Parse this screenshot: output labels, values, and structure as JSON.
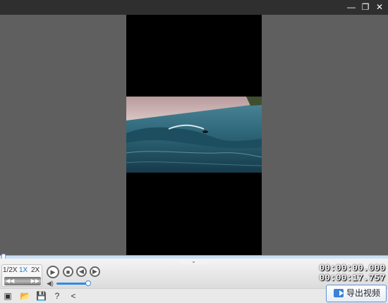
{
  "window": {
    "minimize_glyph": "—",
    "restore_glyph": "❐",
    "close_glyph": "✕"
  },
  "controls": {
    "speed_options": [
      "1/2X",
      "1X",
      "2X"
    ],
    "active_speed": "1X",
    "jog_left": "◀◀",
    "jog_right": "▶▶",
    "play_glyph": "▶",
    "stop_glyph": "■",
    "prev_glyph": "◀",
    "next_glyph": "▶",
    "volume_glyph": "◀)",
    "collapse_glyph": "⌄",
    "volume_level": 0.85,
    "progress": 0.0
  },
  "timecodes": {
    "current": "00:00:00.000",
    "total": "00:00:17.757"
  },
  "toolbar": {
    "tool1_glyph": "▣",
    "tool2_glyph": "📂",
    "tool3_glyph": "💾",
    "tool4_glyph": "?",
    "tool5_glyph": "<"
  },
  "export": {
    "label": "导出视频"
  },
  "colors": {
    "accent": "#2f8ae5",
    "titlebar": "#2f2f2f",
    "stage": "#5f5f5f"
  }
}
